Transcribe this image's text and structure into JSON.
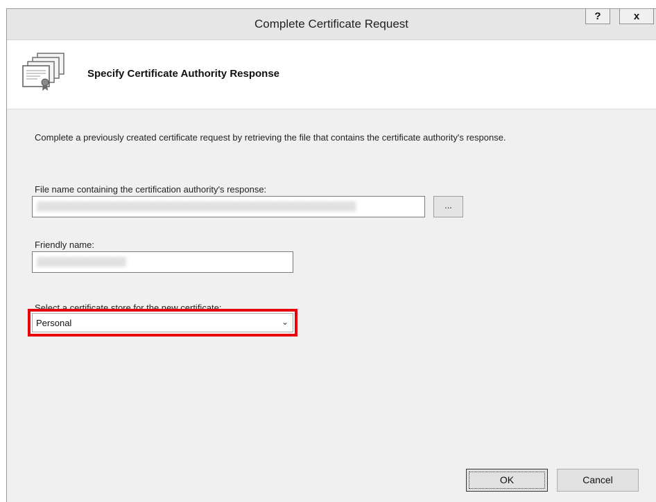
{
  "window": {
    "title": "Complete Certificate Request",
    "help_label": "?",
    "close_label": "x"
  },
  "header": {
    "title": "Specify Certificate Authority Response",
    "icon": "certificate-icon"
  },
  "main": {
    "description": "Complete a previously created certificate request by retrieving the file that contains the certificate authority's response.",
    "file_label": "File name containing the certification authority's response:",
    "file_value": "",
    "browse_label": "...",
    "friendly_label": "Friendly name:",
    "friendly_value": "",
    "store_label": "Select a certificate store for the new certificate:",
    "store_selected": "Personal"
  },
  "buttons": {
    "ok": "OK",
    "cancel": "Cancel"
  },
  "colors": {
    "highlight": "#e8000b"
  }
}
